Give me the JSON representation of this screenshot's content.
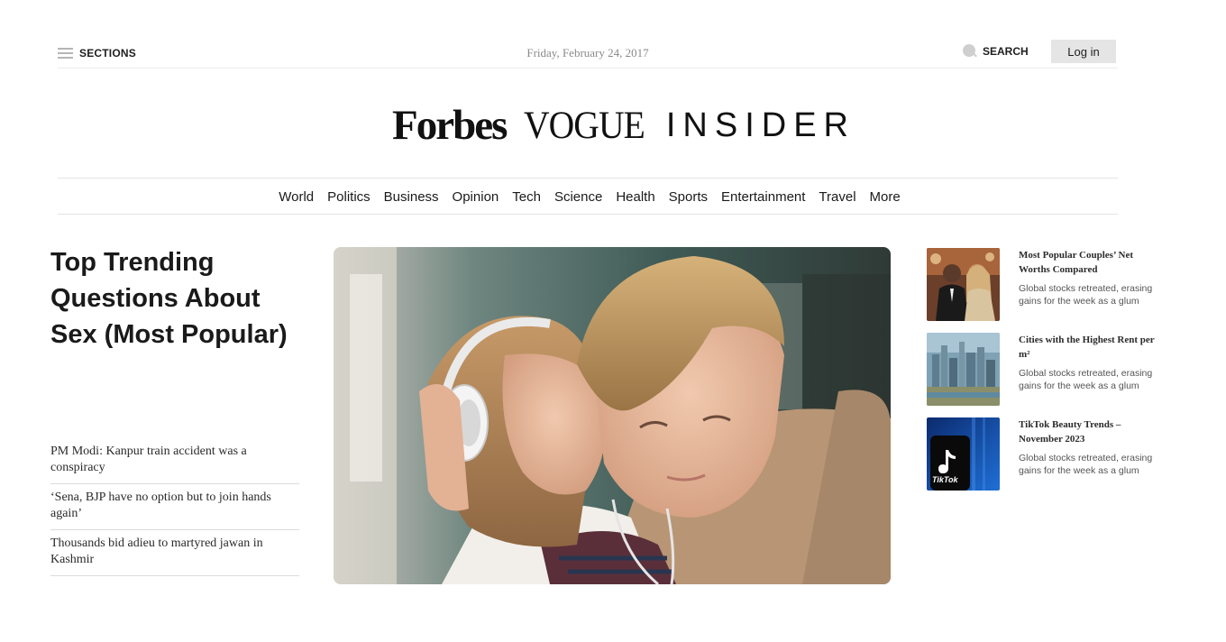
{
  "header": {
    "sections_label": "SECTIONS",
    "date": "Friday, February 24, 2017",
    "search_label": "SEARCH",
    "login_label": "Log in"
  },
  "logos": {
    "forbes": "Forbes",
    "vogue": "VOGUE",
    "insider": "INSIDER"
  },
  "nav": {
    "items": [
      "World",
      "Politics",
      "Business",
      "Opinion",
      "Tech",
      "Science",
      "Health",
      "Sports",
      "Entertainment",
      "Travel",
      "More"
    ]
  },
  "main": {
    "headline": "Top Trending Questions About Sex (Most Popular)",
    "news": [
      "PM Modi: Kanpur train accident was a conspiracy",
      "‘Sena, BJP have no option but to join hands again’",
      "Thousands bid adieu to martyred jawan in Kashmir"
    ]
  },
  "sidebar": {
    "items": [
      {
        "title": "Most Popular Couples’ Net Worths Compared",
        "desc": "Global stocks retreated, erasing gains for the week as a glum",
        "thumb": "celebrity-couple-photo"
      },
      {
        "title": "Cities with the Highest Rent per m²",
        "desc": "Global stocks retreated, erasing gains for the week as a glum",
        "thumb": "city-skyline-photo"
      },
      {
        "title": "TikTok Beauty Trends – November 2023",
        "desc": "Global stocks retreated, erasing gains for the week as a glum",
        "thumb": "tiktok-logo-photo",
        "thumb_text": "TikTok"
      }
    ]
  },
  "colors": {
    "login_bg": "#e5e5e5",
    "divider": "#e3e3e3",
    "muted_text": "#8a8a8a"
  }
}
